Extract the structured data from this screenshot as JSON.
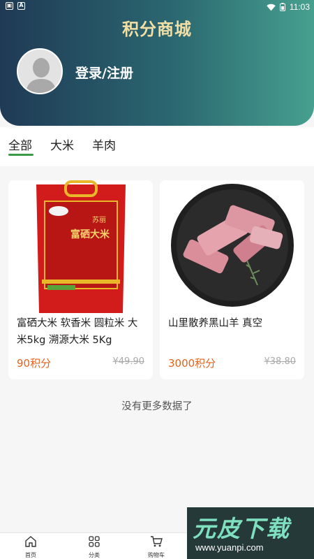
{
  "status_bar": {
    "time": "11:03",
    "left_icons": [
      "notification-icon",
      "font-icon"
    ],
    "right_icons": [
      "wifi-icon",
      "battery-icon"
    ]
  },
  "header": {
    "title": "积分商城",
    "login_text": "登录/注册"
  },
  "tabs": [
    {
      "label": "全部",
      "active": true
    },
    {
      "label": "大米",
      "active": false
    },
    {
      "label": "羊肉",
      "active": false
    }
  ],
  "products": [
    {
      "name": "富硒大米 软香米 圆粒米 大米5kg 溯源大米 5Kg",
      "price": "90积分",
      "original_price": "¥49.90",
      "bag_brand": "苏丽",
      "bag_title": "富硒大米"
    },
    {
      "name": "山里散养黑山羊 真空",
      "price": "3000积分",
      "original_price": "¥38.80"
    }
  ],
  "list_footer": "没有更多数据了",
  "bottom_nav": [
    {
      "label": "首页",
      "icon": "home-icon"
    },
    {
      "label": "分类",
      "icon": "category-icon"
    },
    {
      "label": "购物车",
      "icon": "cart-icon"
    }
  ],
  "watermark": {
    "main": "元皮下载",
    "url": "www.yuanpi.com"
  },
  "colors": {
    "header_gradient": [
      "#1f3a55",
      "#46a08f"
    ],
    "title": "#f1dfa6",
    "price": "#e2631c",
    "tab_indicator": "#3a9a4a"
  }
}
